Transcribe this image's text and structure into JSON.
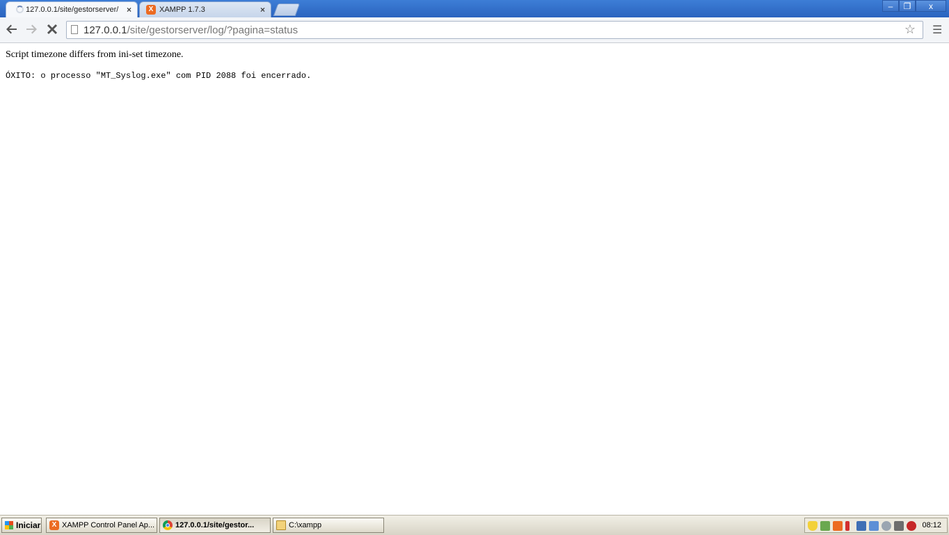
{
  "browser": {
    "tabs": [
      {
        "title": "127.0.0.1/site/gestorserver/",
        "close": "×"
      },
      {
        "title": "XAMPP 1.7.3",
        "close": "×",
        "favicon": "X"
      }
    ],
    "window_controls": {
      "minimize": "–",
      "restore": "❐",
      "close": "x"
    },
    "address": {
      "host": "127.0.0.1",
      "path": "/site/gestorserver/log/?pagina=status"
    },
    "icons": {
      "back": "arrow-left",
      "forward": "arrow-right",
      "stop": "stop-x",
      "star": "star",
      "menu": "wrench-menu"
    }
  },
  "page": {
    "warning": "Script timezone differs from ini-set timezone.",
    "result": "ÓXITO: o processo \"MT_Syslog.exe\" com PID 2088 foi encerrado."
  },
  "taskbar": {
    "start_label": "Iniciar",
    "tasks": [
      {
        "label": "XAMPP Control Panel Ap..."
      },
      {
        "label": "127.0.0.1/site/gestor..."
      },
      {
        "label": "C:\\xampp"
      }
    ],
    "clock": "08:12"
  },
  "colors": {
    "titlebar": "#2f6dc9",
    "xampp_orange": "#ec6b22"
  }
}
